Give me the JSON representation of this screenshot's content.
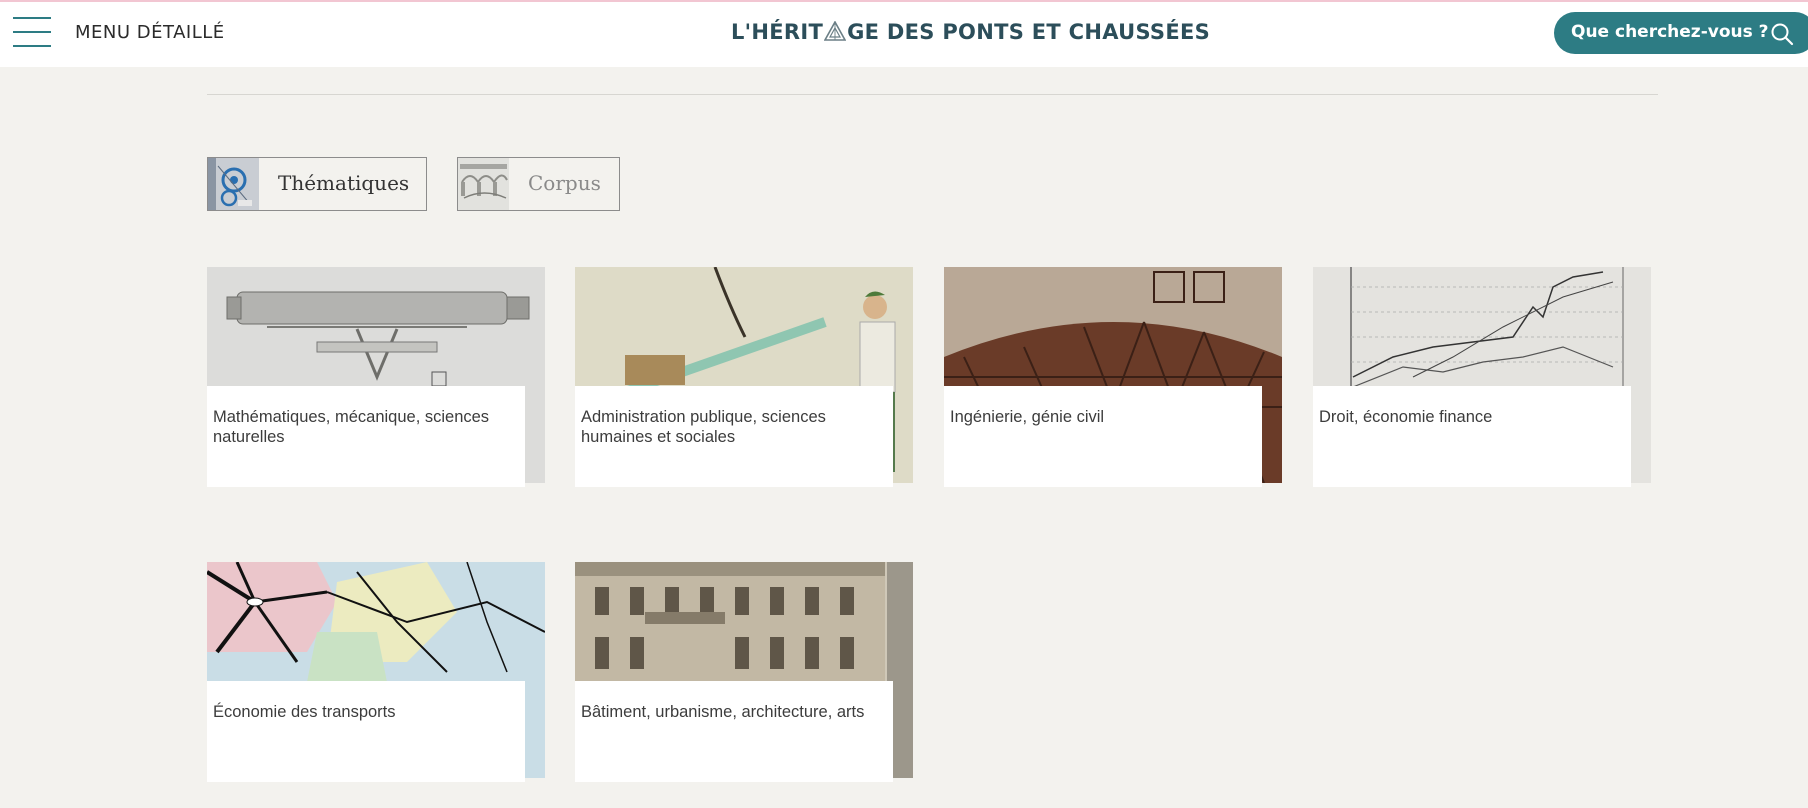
{
  "header": {
    "menu_label": "MENU DÉTAILLÉ",
    "title_before": "L'HÉRIT",
    "title_after": "GE DES PONTS ET CHAUSSÉES",
    "search_label": "Que cherchez-vous ?"
  },
  "tabs": [
    {
      "label": "Thématiques",
      "active": true
    },
    {
      "label": "Corpus",
      "active": false
    }
  ],
  "cards": [
    {
      "label": "Mathématiques, mécanique, sciences naturelles"
    },
    {
      "label": "Administration publique, sciences humaines et sociales"
    },
    {
      "label": "Ingénierie, génie civil"
    },
    {
      "label": "Droit, économie finance"
    },
    {
      "label": "Économie des transports"
    },
    {
      "label": "Bâtiment, urbanisme, architecture, arts"
    }
  ],
  "colors": {
    "accent": "#2d7c84",
    "title": "#2c4e5a",
    "background": "#f3f2ee"
  }
}
